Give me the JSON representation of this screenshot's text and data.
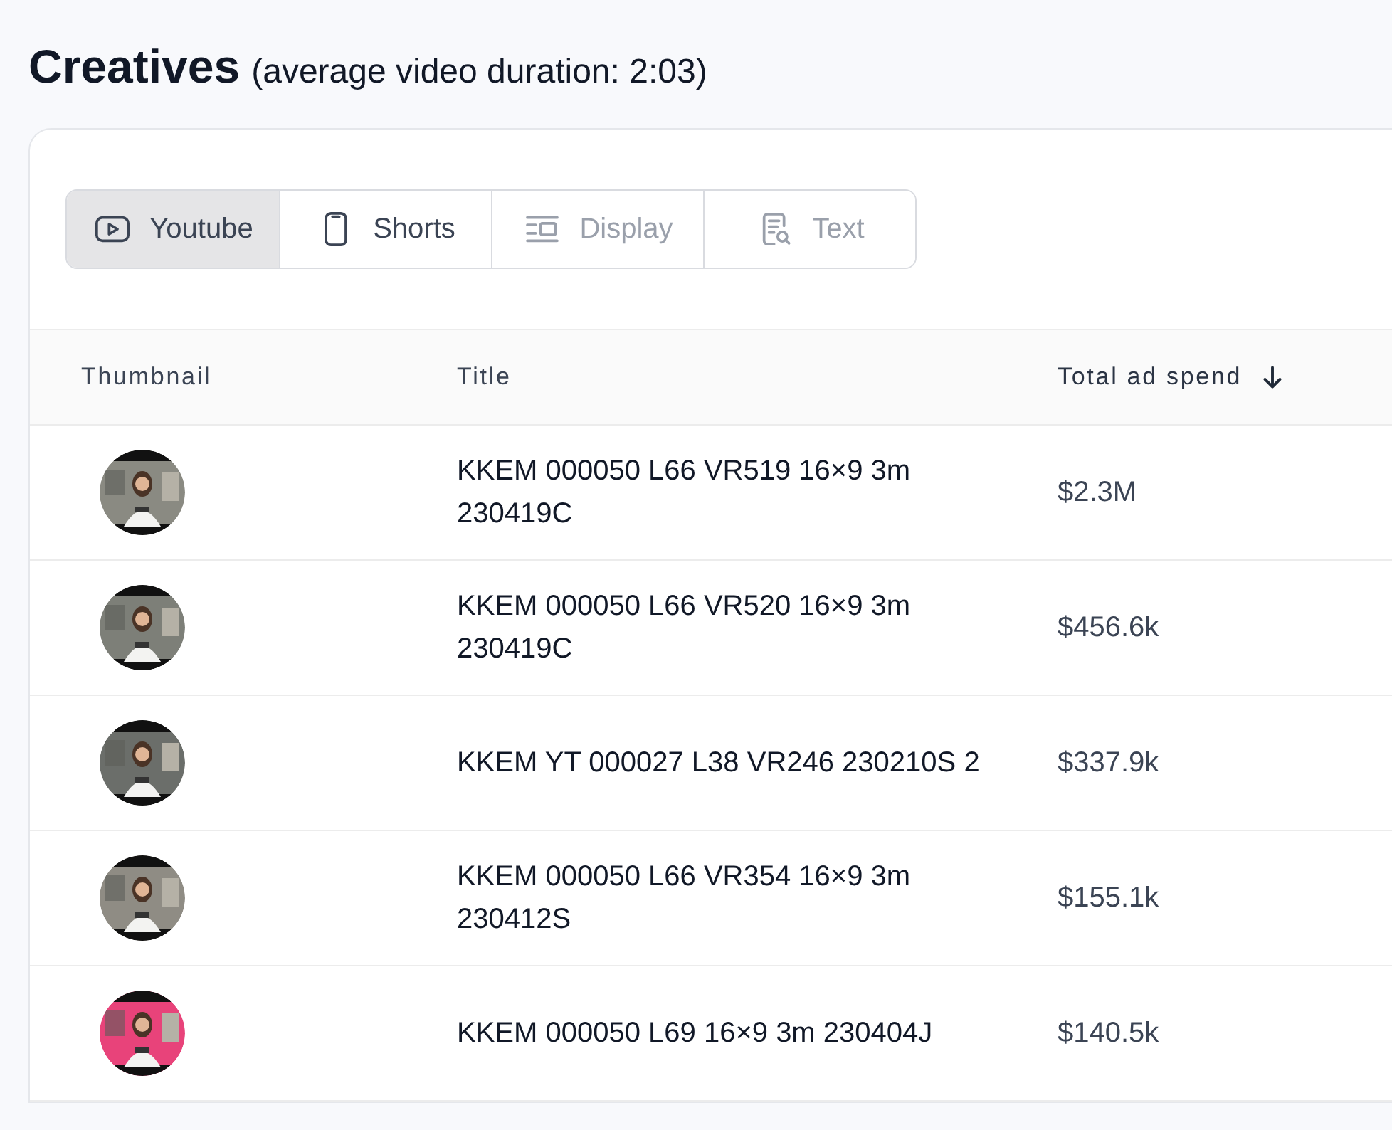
{
  "heading": {
    "title": "Creatives",
    "subtitle": "(average video duration: 2:03)"
  },
  "tabs": [
    {
      "kind": "youtube",
      "label": "Youtube",
      "selected": true,
      "disabled": false
    },
    {
      "kind": "shorts",
      "label": "Shorts",
      "selected": false,
      "disabled": false
    },
    {
      "kind": "display",
      "label": "Display",
      "selected": false,
      "disabled": true
    },
    {
      "kind": "text",
      "label": "Text",
      "selected": false,
      "disabled": true
    }
  ],
  "table": {
    "columns": [
      {
        "label": "Thumbnail",
        "sorted": false
      },
      {
        "label": "Title",
        "sorted": false
      },
      {
        "label": "Total ad spend",
        "sorted": true
      }
    ],
    "rows": [
      {
        "title": "KKEM 000050 L66 VR519 16×9 3m 230419C",
        "spend": "$2.3M"
      },
      {
        "title": "KKEM 000050 L66 VR520 16×9 3m 230419C",
        "spend": "$456.6k"
      },
      {
        "title": "KKEM YT 000027 L38 VR246 230210S 2",
        "spend": "$337.9k"
      },
      {
        "title": "KKEM 000050 L66 VR354 16×9 3m 230412S",
        "spend": "$155.1k"
      },
      {
        "title": "KKEM 000050 L69 16×9 3m 230404J",
        "spend": "$140.5k"
      }
    ]
  }
}
